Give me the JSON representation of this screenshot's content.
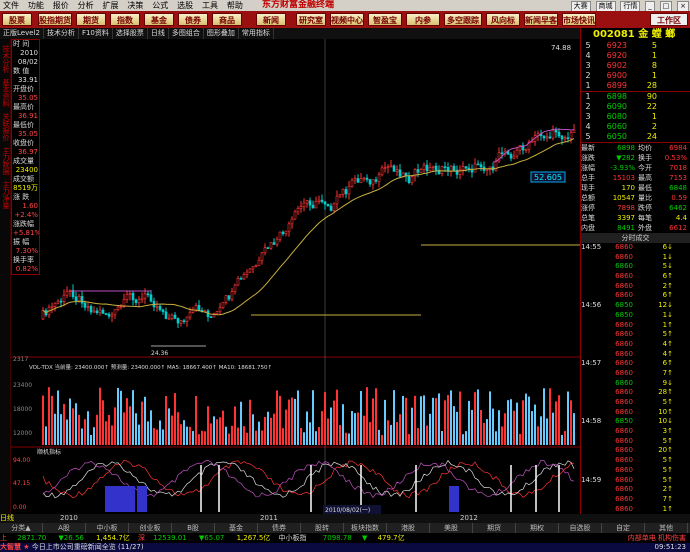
{
  "menubar": {
    "items": [
      "文件",
      "功能",
      "报价",
      "分析",
      "扩展",
      "决策",
      "公式",
      "选股",
      "工具",
      "帮助"
    ],
    "brand": "东方财富金融终端",
    "win": [
      "大赛",
      "商城",
      "行情"
    ]
  },
  "nav": [
    "股票",
    "股指期货",
    "期货",
    "指数",
    "基金",
    "债券",
    "商品",
    "新闻",
    "研究室",
    "视频中心",
    "智盈宝",
    "内参",
    "多空跟踪",
    "风向标",
    "新闻早客",
    "市场快讯",
    "工作区"
  ],
  "toolbar": [
    "正版Level2",
    "技术分析",
    "F10资料",
    "选择股票",
    "日线",
    "多图组合",
    "图形叠加",
    "常用指标"
  ],
  "leftstrip": [
    "技术分析",
    "基本资料",
    "关联报价",
    "主力数据",
    "主力净量"
  ],
  "info": {
    "rows": [
      {
        "l": "时 间",
        "v": "2010",
        "c": "w"
      },
      {
        "v": "08/02",
        "c": "w"
      },
      {
        "l": "数 值",
        "v": "33.91",
        "c": "w"
      },
      {
        "l": "开盘价",
        "v": "35.05",
        "c": "r"
      },
      {
        "l": "最高价",
        "v": "36.91",
        "c": "r"
      },
      {
        "l": "最低价",
        "v": "35.05",
        "c": "r"
      },
      {
        "l": "收盘价",
        "v": "36.97",
        "c": "r"
      },
      {
        "l": "成交量",
        "v": "23400",
        "c": "y"
      },
      {
        "l": "成交额",
        "v": "8519万",
        "c": "y"
      },
      {
        "l": "涨 跌",
        "v": "1.60",
        "c": "r"
      },
      {
        "l": "",
        "v": "+2.4%",
        "c": "r"
      },
      {
        "l": "涨跌幅",
        "v": "+5.81%",
        "c": "r"
      },
      {
        "l": "振 幅",
        "v": "7.30%",
        "c": "r"
      },
      {
        "l": "换手率",
        "v": "0.82%",
        "c": "r"
      }
    ]
  },
  "chart": {
    "price_high": "74.88",
    "last": "52.605",
    "low": "24.36",
    "left_val": "2317",
    "date_cursor": "2010/08/02(一)",
    "vol_line": "VOL-TDX  当前量: 23400.000↑ 预测量: 23400.000↑ MA5: 18667.400↑ MA10: 18681.750↑",
    "sub_label": "顺机指标",
    "sub_l": "94.00",
    "sub_m": "47.15",
    "sub_b": "0.00",
    "axis_left_vol": [
      "23400",
      "18000",
      "12000",
      "6000"
    ]
  },
  "right": {
    "code": "002081 金 螳 螂",
    "sell": [
      {
        "l": "5",
        "p": "6923",
        "v": "5"
      },
      {
        "l": "4",
        "p": "6920",
        "v": "1"
      },
      {
        "l": "3",
        "p": "6902",
        "v": "8"
      },
      {
        "l": "2",
        "p": "6900",
        "v": "1"
      },
      {
        "l": "1",
        "p": "6899",
        "v": "28"
      }
    ],
    "buy": [
      {
        "l": "1",
        "p": "6898",
        "v": "90"
      },
      {
        "l": "2",
        "p": "6090",
        "v": "22"
      },
      {
        "l": "3",
        "p": "6080",
        "v": "1"
      },
      {
        "l": "4",
        "p": "6060",
        "v": "2"
      },
      {
        "l": "5",
        "p": "6050",
        "v": "24"
      }
    ],
    "stats": [
      {
        "l": "最新",
        "v": "6898",
        "c": "g",
        "l2": "均价",
        "v2": "6984",
        "c2": "r"
      },
      {
        "l": "涨跌",
        "v": "▼282",
        "c": "g",
        "l2": "换手",
        "v2": "0.53%",
        "c2": "r"
      },
      {
        "l": "涨幅",
        "v": "-3.93%",
        "c": "g",
        "l2": "今开",
        "v2": "7018",
        "c2": "r"
      },
      {
        "l": "总手",
        "v": "15103",
        "c": "r",
        "l2": "最高",
        "v2": "7153",
        "c2": "r"
      },
      {
        "l": "现手",
        "v": "170",
        "c": "y",
        "l2": "最低",
        "v2": "6848",
        "c2": "g"
      },
      {
        "l": "总额",
        "v": "10547",
        "c": "y",
        "l2": "量比",
        "v2": "0.59",
        "c2": "r"
      },
      {
        "l": "涨停",
        "v": "7898",
        "c": "r",
        "l2": "跌停",
        "v2": "6462",
        "c2": "g"
      },
      {
        "l": "总笔",
        "v": "3397",
        "c": "y",
        "l2": "每笔",
        "v2": "4.4",
        "c2": "y"
      },
      {
        "l": "内盘",
        "v": "8491",
        "c": "g",
        "l2": "外盘",
        "v2": "6612",
        "c2": "r"
      }
    ],
    "trade_head": "分时成交",
    "trades": [
      {
        "t": "14:55",
        "p": "6860",
        "c": "r",
        "v": "6↓"
      },
      {
        "t": "",
        "p": "6860",
        "c": "r",
        "v": "1↓"
      },
      {
        "t": "",
        "p": "6860",
        "c": "g",
        "v": "5↓"
      },
      {
        "t": "",
        "p": "6860",
        "c": "r",
        "v": "6↑"
      },
      {
        "t": "",
        "p": "6860",
        "c": "r",
        "v": "2↑"
      },
      {
        "t": "",
        "p": "6860",
        "c": "r",
        "v": "6↑"
      },
      {
        "t": "14:56",
        "p": "6850",
        "c": "g",
        "v": "12↓"
      },
      {
        "t": "",
        "p": "6850",
        "c": "g",
        "v": "1↓"
      },
      {
        "t": "",
        "p": "6860",
        "c": "r",
        "v": "1↑"
      },
      {
        "t": "",
        "p": "6860",
        "c": "r",
        "v": "5↑"
      },
      {
        "t": "",
        "p": "6860",
        "c": "r",
        "v": "4↑"
      },
      {
        "t": "",
        "p": "6860",
        "c": "r",
        "v": "4↑"
      },
      {
        "t": "14:57",
        "p": "6860",
        "c": "r",
        "v": "6↑"
      },
      {
        "t": "",
        "p": "6860",
        "c": "r",
        "v": "7↑"
      },
      {
        "t": "",
        "p": "6860",
        "c": "g",
        "v": "9↓"
      },
      {
        "t": "",
        "p": "6860",
        "c": "r",
        "v": "28↑"
      },
      {
        "t": "",
        "p": "6860",
        "c": "r",
        "v": "5↑"
      },
      {
        "t": "",
        "p": "6860",
        "c": "r",
        "v": "10↑"
      },
      {
        "t": "14:58",
        "p": "6850",
        "c": "g",
        "v": "10↓"
      },
      {
        "t": "",
        "p": "6860",
        "c": "r",
        "v": "3↑"
      },
      {
        "t": "",
        "p": "6860",
        "c": "r",
        "v": "5↑"
      },
      {
        "t": "",
        "p": "6860",
        "c": "r",
        "v": "20↑"
      },
      {
        "t": "",
        "p": "6860",
        "c": "r",
        "v": "5↑"
      },
      {
        "t": "",
        "p": "6860",
        "c": "r",
        "v": "5↑"
      },
      {
        "t": "14:59",
        "p": "6860",
        "c": "r",
        "v": "5↑"
      },
      {
        "t": "",
        "p": "6860",
        "c": "r",
        "v": "2↑"
      },
      {
        "t": "",
        "p": "6860",
        "c": "r",
        "v": "7↑"
      },
      {
        "t": "",
        "p": "6860",
        "c": "r",
        "v": "1↑"
      },
      {
        "t": "",
        "p": "6860",
        "c": "r",
        "v": "8↑"
      },
      {
        "t": "",
        "p": "6880",
        "c": "r",
        "v": "9↑"
      },
      {
        "t": "15:00",
        "p": "6898",
        "c": "g",
        "v": "170↓"
      }
    ]
  },
  "timebar": {
    "label": "日线",
    "ticks": [
      "2010",
      "2011",
      "2012"
    ]
  },
  "tabs": [
    "分类▲",
    "A股",
    "中小板",
    "创业板",
    "B股",
    "基金",
    "债券",
    "股转",
    "板块指数",
    "港股",
    "美股",
    "期货",
    "期权",
    "自选股",
    "自定",
    "其他"
  ],
  "status": {
    "sh_label": "上",
    "sh_val": "2871.70",
    "sh_chg": "▼26.56",
    "sh_amt": "1,454.7亿",
    "sz_label": "深",
    "sz_val": "12539.01",
    "sz_chg": "▼65.07",
    "sz_amt": "1,267.5亿",
    "zx_label": "中小板指",
    "zx_val": "7098.78",
    "zx_chg": "▼",
    "zx_amt": "479.7亿",
    "right_text": "内部单电 机构伤害"
  },
  "news": {
    "left": "大智慧",
    "text": "今日上市公司重磅新闻全览 (11/27)",
    "time": "09:51:23"
  }
}
